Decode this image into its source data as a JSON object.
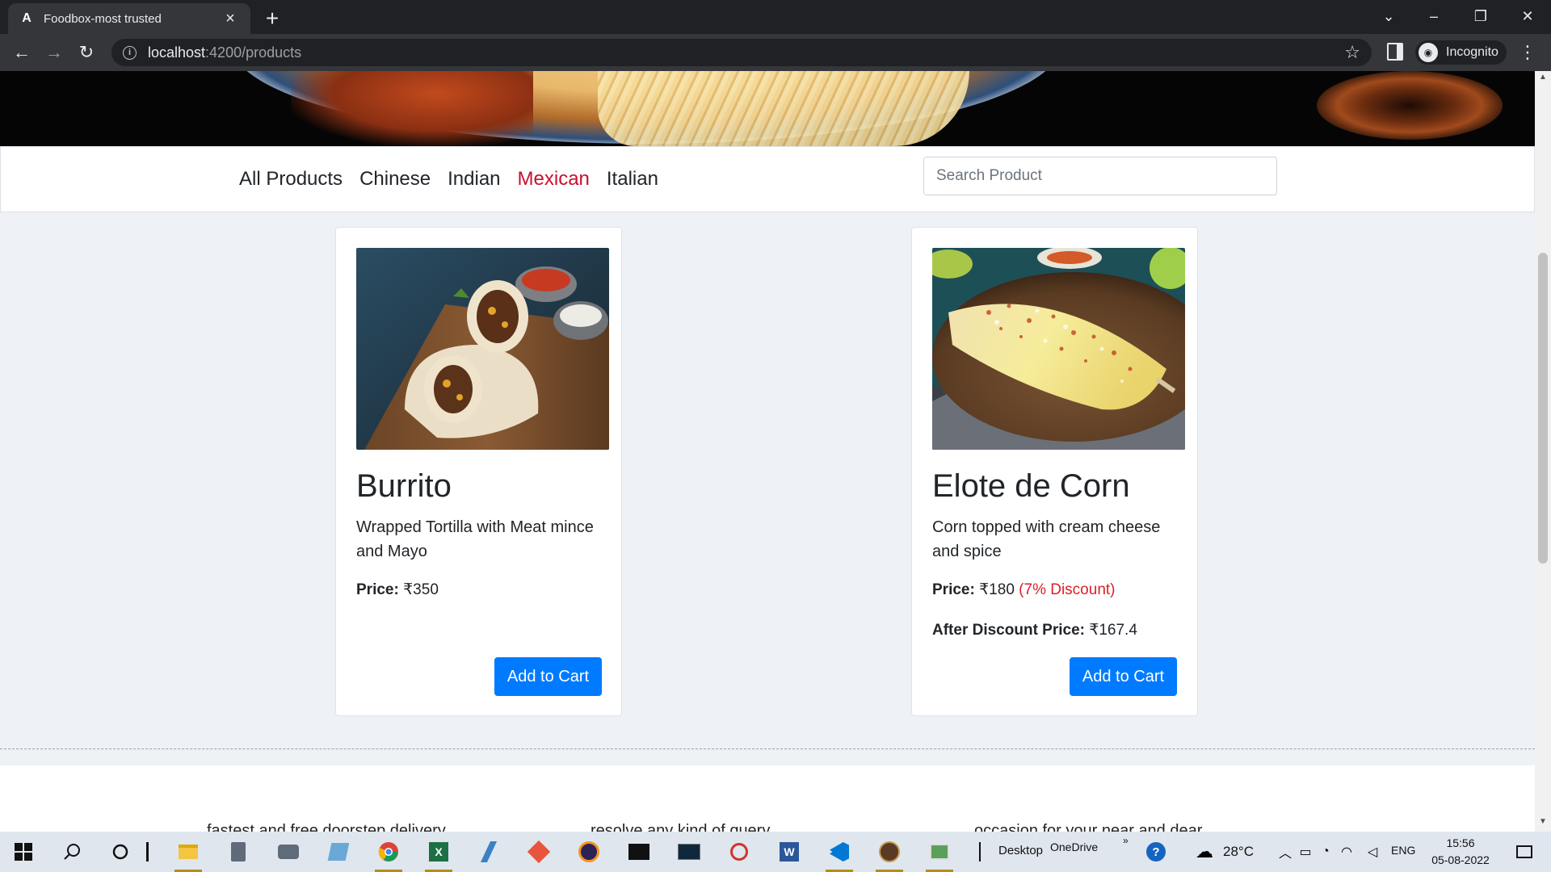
{
  "browser": {
    "tab_title": "Foodbox-most trusted",
    "url_host": "localhost",
    "url_path": ":4200/products",
    "profile_label": "Incognito"
  },
  "nav": {
    "links": [
      "All Products",
      "Chinese",
      "Indian",
      "Mexican",
      "Italian"
    ],
    "active": "Mexican",
    "search_placeholder": "Search Product"
  },
  "products": [
    {
      "name": "Burrito",
      "description": "Wrapped Tortilla with Meat mince and Mayo",
      "price_label": "Price:",
      "price": "₹350",
      "discount": "",
      "after_label": "",
      "after_price": "",
      "button": "Add to Cart"
    },
    {
      "name": "Elote de Corn",
      "description": "Corn topped with cream cheese and spice",
      "price_label": "Price:",
      "price": "₹180",
      "discount": "(7% Discount)",
      "after_label": "After Discount Price:",
      "after_price": "₹167.4",
      "button": "Add to Cart"
    }
  ],
  "footer": {
    "texts": [
      "fastest and free doorstep delivery",
      "resolve any kind of query",
      "occasion for your near and dear"
    ]
  },
  "taskbar": {
    "desktop_label": "Desktop",
    "onedrive_label": "OneDrive",
    "temperature": "28°C",
    "language": "ENG",
    "time": "15:56",
    "date": "05-08-2022"
  },
  "colors": {
    "accent": "#007bff",
    "active_nav": "#c8102e",
    "discount": "#d92027"
  }
}
